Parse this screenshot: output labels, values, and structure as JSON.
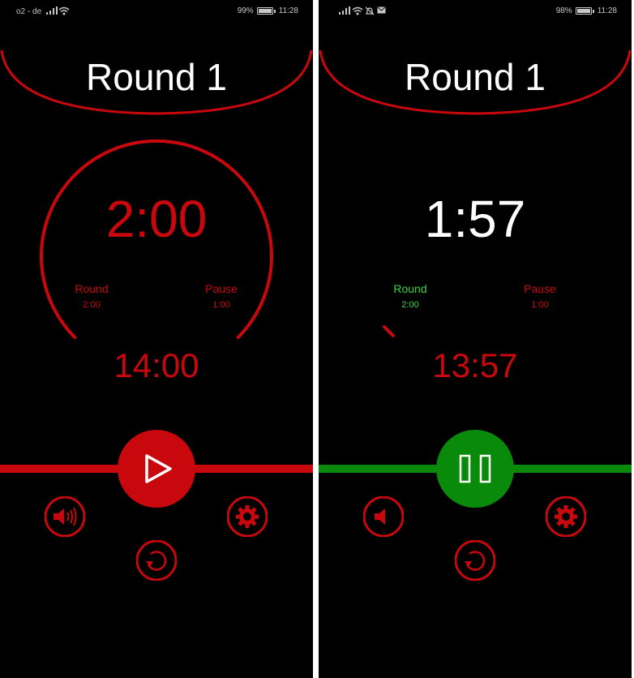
{
  "left": {
    "status": {
      "carrier": "o2 - de",
      "battery": "99%",
      "time": "11:28"
    },
    "title": "Round 1",
    "timer": "2:00",
    "round_label": "Round",
    "round_value": "2:00",
    "pause_label": "Pause",
    "pause_value": "1:00",
    "total": "14:00",
    "state": "stopped",
    "buttons": {
      "main": "play-icon",
      "sound": "speaker-loud-icon",
      "settings": "gear-icon",
      "reset": "reset-icon"
    }
  },
  "right": {
    "status": {
      "battery": "98%",
      "time": "11:28"
    },
    "title": "Round 1",
    "timer": "1:57",
    "round_label": "Round",
    "round_value": "2:00",
    "pause_label": "Pause",
    "pause_value": "1:00",
    "total": "13:57",
    "state": "running",
    "buttons": {
      "main": "pause-icon",
      "sound": "speaker-icon",
      "settings": "gear-icon",
      "reset": "reset-icon"
    }
  },
  "colors": {
    "red": "#c8080d",
    "green": "#0a8a0a",
    "active_green": "#3fd43f",
    "white": "#ffffff",
    "background": "#000000"
  }
}
